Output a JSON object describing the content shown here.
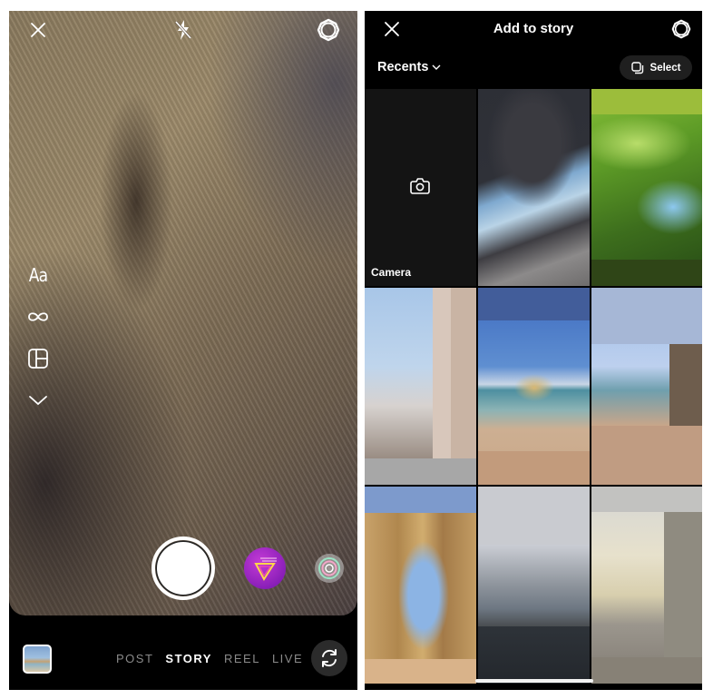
{
  "camera": {
    "top_bar": {
      "close_icon": "close-icon",
      "flash_icon": "flash-off-icon",
      "settings_icon": "gear-icon"
    },
    "side_tools": [
      {
        "name": "create-text",
        "label": "Aa",
        "icon": "text-icon"
      },
      {
        "name": "boomerang",
        "label": "",
        "icon": "infinity-icon"
      },
      {
        "name": "layout",
        "label": "",
        "icon": "layout-icon"
      },
      {
        "name": "more",
        "label": "",
        "icon": "chevron-down-icon"
      }
    ],
    "shutter_icon": "shutter-button",
    "effects": [
      {
        "name": "neon-triangle-effect",
        "colors": [
          "#c43bd6",
          "#ffd54a"
        ]
      },
      {
        "name": "rings-effect",
        "colors": [
          "#9be3c4",
          "#f3a6c8"
        ]
      }
    ],
    "modes": [
      {
        "label": "POST",
        "active": false
      },
      {
        "label": "STORY",
        "active": true
      },
      {
        "label": "REEL",
        "active": false
      },
      {
        "label": "LIVE",
        "active": false
      }
    ],
    "flip_icon": "flip-camera-icon"
  },
  "story": {
    "title": "Add to story",
    "close_icon": "close-icon",
    "settings_icon": "gear-icon",
    "album": {
      "label": "Recents",
      "icon": "chevron-down-icon"
    },
    "select": {
      "label": "Select",
      "icon": "multi-select-icon"
    },
    "camera_tile": {
      "label": "Camera",
      "icon": "camera-icon"
    },
    "photos": [
      {
        "description": "rocky coast with waves"
      },
      {
        "description": "banana leaves under blue sky"
      },
      {
        "description": "street with church tower and stop sign"
      },
      {
        "description": "beach with sea stack"
      },
      {
        "description": "sandy beach with cliffs"
      },
      {
        "description": "sea arch on beach"
      },
      {
        "description": "Forth bridge over water"
      },
      {
        "description": "cobbled square with houses and bridge"
      }
    ]
  },
  "colors": {
    "background": "#000000",
    "active_mode": "#ffffff",
    "inactive_mode": "#8a8a8a",
    "select_button": "#1f1f1f"
  }
}
